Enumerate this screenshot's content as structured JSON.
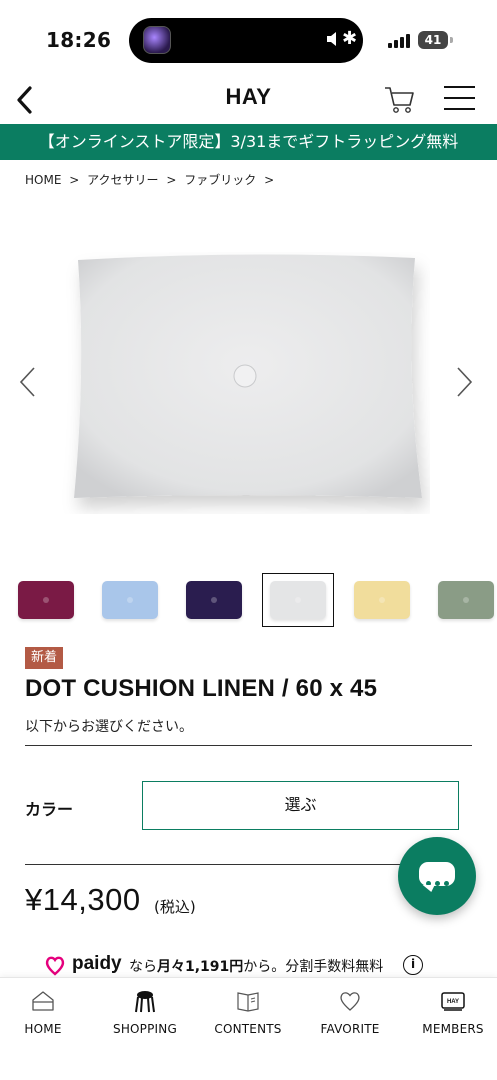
{
  "status": {
    "time": "18:26",
    "battery": "41"
  },
  "header": {
    "logo": "HAY"
  },
  "promo": {
    "text": "【オンラインストア限定】3/31までギフトラッピング無料"
  },
  "breadcrumb": [
    {
      "label": "HOME"
    },
    {
      "label": ">"
    },
    {
      "label": "アクセサリー"
    },
    {
      "label": ">"
    },
    {
      "label": "ファブリック"
    },
    {
      "label": ">"
    }
  ],
  "gallery": {
    "main_color": "#e6e7e8",
    "thumbnails": [
      {
        "color": "#7a1a45",
        "selected": false
      },
      {
        "color": "#a9c6ea",
        "selected": false
      },
      {
        "color": "#2a1d4f",
        "selected": false
      },
      {
        "color": "#e4e5e6",
        "selected": true
      },
      {
        "color": "#f1dd9c",
        "selected": false
      },
      {
        "color": "#8a9c86",
        "selected": false
      }
    ]
  },
  "product": {
    "badge": "新着",
    "title": "DOT CUSHION LINEN / 60 x 45",
    "select_prompt": "以下からお選びください。",
    "color_label": "カラー",
    "color_select": "選ぶ",
    "price": "¥14,300",
    "price_note": "(税込)"
  },
  "paidy": {
    "brand": "paidy",
    "text_prefix": "なら",
    "text_bold": "月々1,191円",
    "text_suffix": "から。分割手数料無料",
    "info": "i"
  },
  "nav": [
    {
      "label": "HOME",
      "icon": "home-icon"
    },
    {
      "label": "SHOPPING",
      "icon": "chair-icon"
    },
    {
      "label": "CONTENTS",
      "icon": "book-icon"
    },
    {
      "label": "FAVORITE",
      "icon": "heart-icon"
    },
    {
      "label": "MEMBERS",
      "icon": "member-card-icon"
    }
  ],
  "colors": {
    "accent": "#0b7d61",
    "badge": "#b35a45",
    "paidy": "#e5007d"
  }
}
